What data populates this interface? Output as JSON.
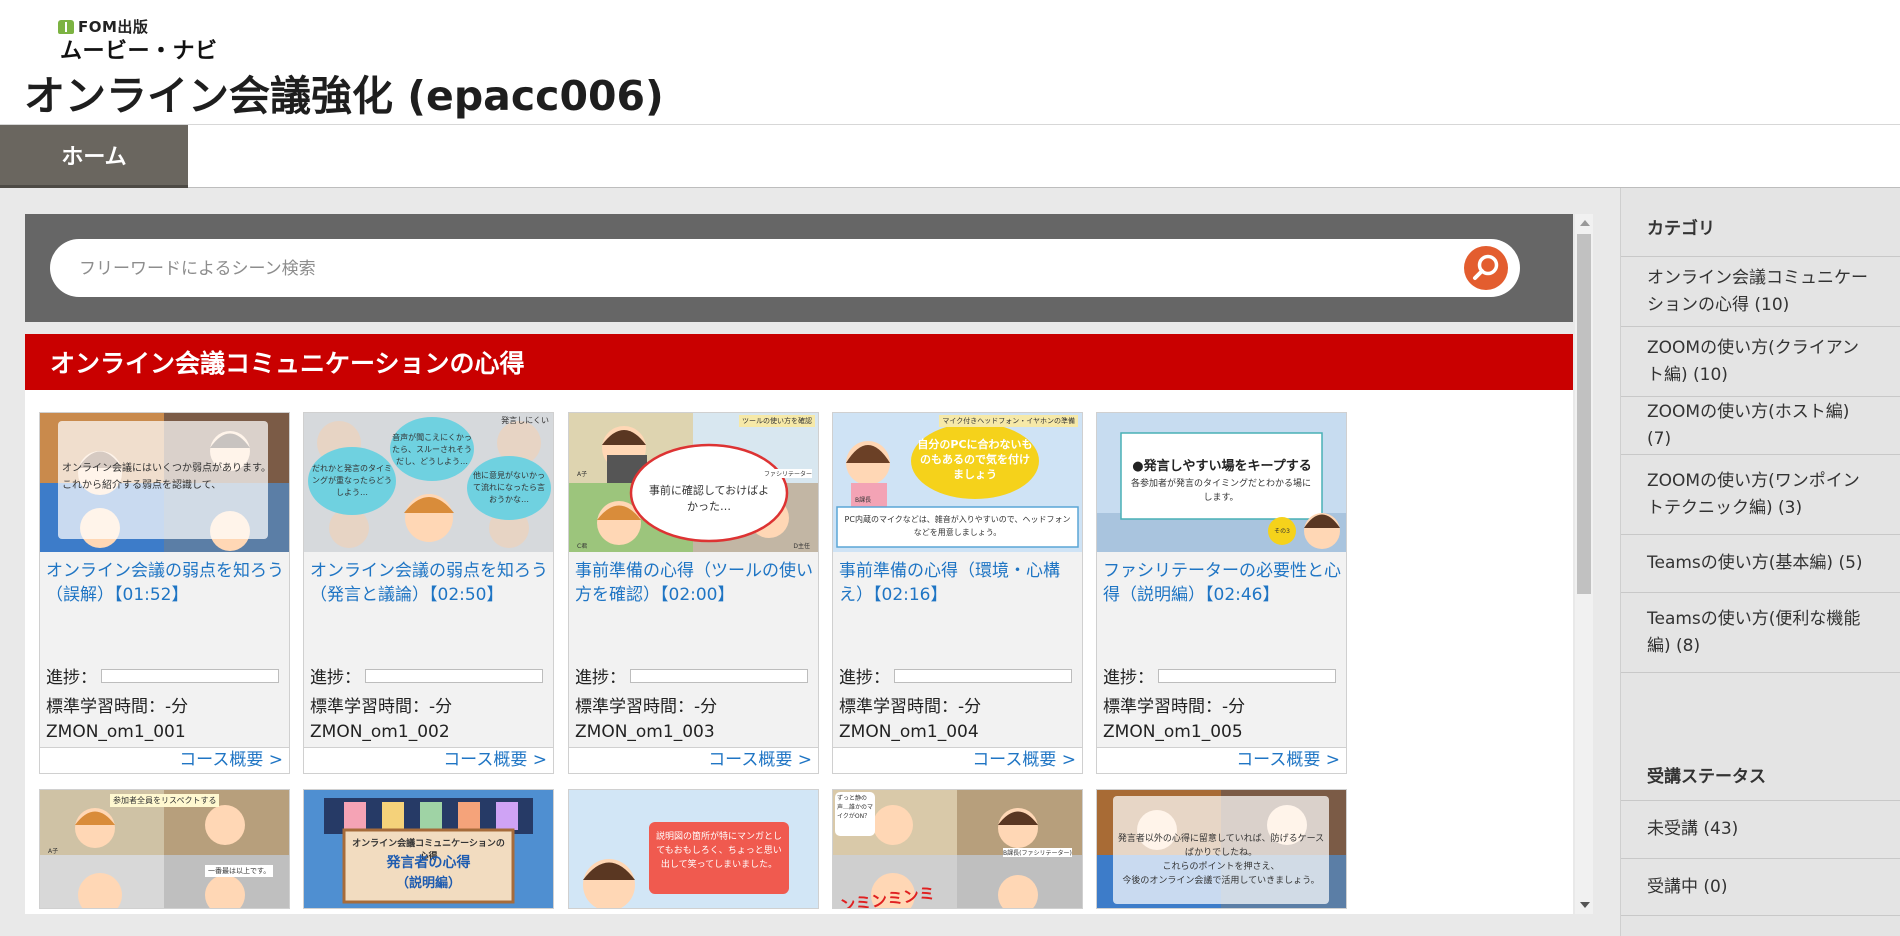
{
  "header": {
    "logo_top": "FOM出版",
    "logo_main": "ムービー・ナビ",
    "title": "オンライン会議強化 (epacc006)"
  },
  "nav": {
    "home": "ホーム"
  },
  "search": {
    "placeholder": "フリーワードによるシーン検索"
  },
  "category_heading": "オンライン会議コミュニケーションの心得",
  "labels": {
    "progress": "進捗：",
    "course_link": "コース概要 >"
  },
  "cards": [
    {
      "title": "オンライン会議の弱点を知ろう（誤解）【01:52】",
      "time": "標準学習時間：-分",
      "code": "ZMON_om1_001",
      "thumb_text": [
        "オンライン会議にはいくつか弱点があります。",
        "これから紹介する弱点を認識して、"
      ],
      "progress": 0
    },
    {
      "title": "オンライン会議の弱点を知ろう（発言と議論）【02:50】",
      "time": "標準学習時間：-分",
      "code": "ZMON_om1_002",
      "thumb_text": [
        "だれかと発言のタイミングが重なったらどうしよう…",
        "音声が聞こえにくかったら、スルーされそうだし、どうしよう…",
        "他に意見がないかって流れになったら言おうかな…",
        "発言しにくい"
      ],
      "progress": 0
    },
    {
      "title": "事前準備の心得（ツールの使い方を確認）【02:00】",
      "time": "標準学習時間：-分",
      "code": "ZMON_om1_003",
      "thumb_text": [
        "事前に確認しておけばよかった…",
        "ツールの使い方を確認",
        "ファシリテーター",
        "A子",
        "C君",
        "D主任"
      ],
      "progress": 0
    },
    {
      "title": "事前準備の心得（環境・心構え）【02:16】",
      "time": "標準学習時間：-分",
      "code": "ZMON_om1_004",
      "thumb_text": [
        "自分のPCに合わないものもあるので気を付けましょう",
        "マイク付きヘッドフォン・イヤホンの準備",
        "PC内蔵のマイクなどは、雑音が入りやすいので、ヘッドフォンなどを用意しましょう。",
        "B課長"
      ],
      "progress": 0
    },
    {
      "title": "ファシリテーターの必要性と心得（説明編）【02:46】",
      "time": "標準学習時間：-分",
      "code": "ZMON_om1_005",
      "thumb_text": [
        "●発言しやすい場をキープする",
        "各参加者が発言のタイミングだとわかる場にします。",
        "その3"
      ],
      "progress": 0
    }
  ],
  "cards_row2_text": [
    [
      "参加者全員をリスペクトする",
      "A子",
      "一番最は以上です。"
    ],
    [
      "オンライン会議コミュニケーションの心得",
      "発言者の心得",
      "（説明編）"
    ],
    [
      "説明図の箇所が特にマンガとしてもおもしろく、ちょっと思い出して笑ってしまいました。"
    ],
    [
      "ずっと静の声…誰かのマイクがON？",
      "B課長(ファシリテーター)",
      "ンミンミンミ"
    ],
    [
      "発言者以外の心得に留意していれば、防げるケースばかりでしたね。",
      "これらのポイントを押さえ、",
      "今後のオンライン会議で活用していきましょう。"
    ]
  ],
  "sidebar": {
    "category_title": "カテゴリ",
    "categories": [
      "オンライン会議コミュニケーションの心得 (10)",
      "ZOOMの使い方(クライアント編) (10)",
      "ZOOMの使い方(ホスト編) (7)",
      "ZOOMの使い方(ワンポイントテクニック編) (3)",
      "Teamsの使い方(基本編) (5)",
      "Teamsの使い方(便利な機能編) (8)"
    ],
    "status_title": "受講ステータス",
    "statuses": [
      "未受講 (43)",
      "受講中 (0)"
    ]
  },
  "colors": {
    "category_bar": "#c90000",
    "search_band": "#666666",
    "nav_active": "#6a665f",
    "link": "#1f75c4",
    "search_button": "#e35d2f",
    "logo_green": "#7cb342"
  }
}
